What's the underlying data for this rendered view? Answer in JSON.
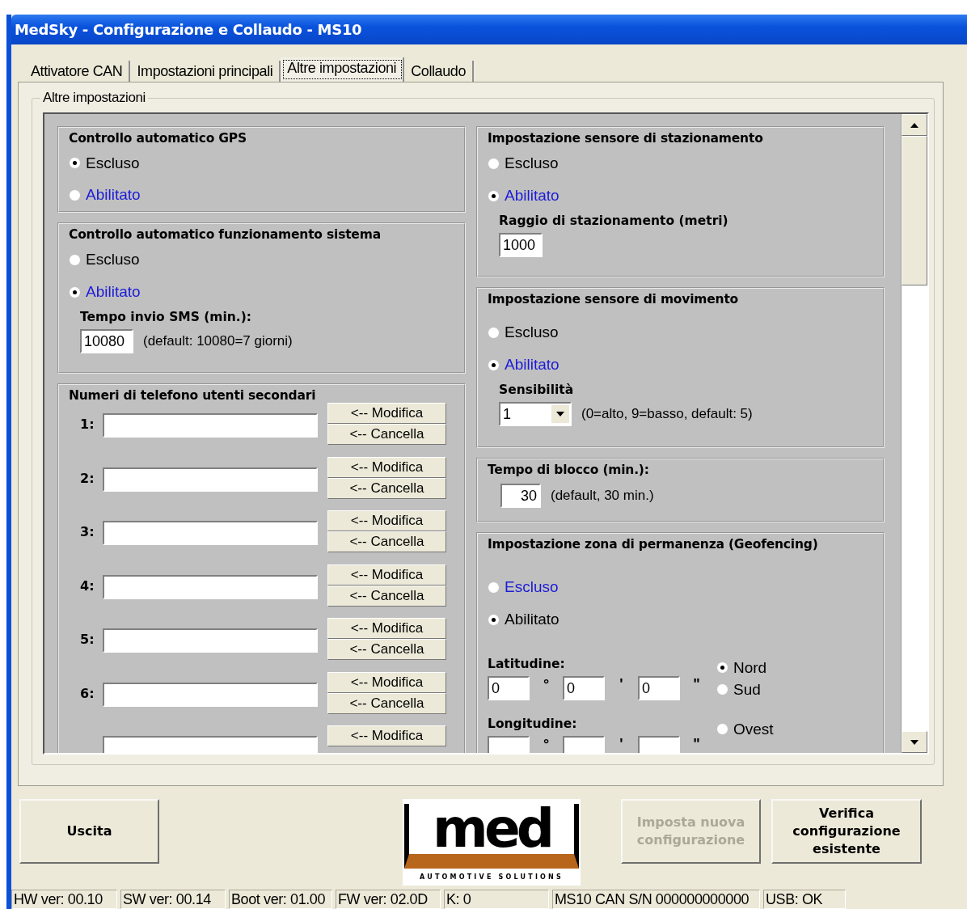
{
  "window": {
    "title": "MedSky - Configurazione e Collaudo - MS10"
  },
  "tabs": [
    {
      "label": "Attivatore CAN",
      "selected": false
    },
    {
      "label": "Impostazioni principali",
      "selected": false
    },
    {
      "label": "Altre impostazioni",
      "selected": true
    },
    {
      "label": "Collaudo",
      "selected": false
    }
  ],
  "group_label": "Altre impostazioni",
  "gps": {
    "title": "Controllo automatico GPS",
    "options": [
      {
        "label": "Escluso",
        "selected": true,
        "color": "#000000"
      },
      {
        "label": "Abilitato",
        "selected": false,
        "color": "#1c1cd8"
      }
    ]
  },
  "system": {
    "title": "Controllo automatico funzionamento sistema",
    "options": [
      {
        "label": "Escluso",
        "selected": false,
        "color": "#000000"
      },
      {
        "label": "Abilitato",
        "selected": true,
        "color": "#1c1cd8"
      }
    ],
    "sms_label": "Tempo invio SMS (min.):",
    "sms_value": "10080",
    "sms_hint": "(default: 10080=7 giorni)"
  },
  "phones": {
    "title": "Numeri di telefono utenti secondari",
    "rows": [
      {
        "label": "1:",
        "modify": "<-- Modifica",
        "delete": "<-- Cancella"
      },
      {
        "label": "2:",
        "modify": "<-- Modifica",
        "delete": "<-- Cancella"
      },
      {
        "label": "3:",
        "modify": "<-- Modifica",
        "delete": "<-- Cancella"
      },
      {
        "label": "4:",
        "modify": "<-- Modifica",
        "delete": "<-- Cancella"
      },
      {
        "label": "5:",
        "modify": "<-- Modifica",
        "delete": "<-- Cancella"
      },
      {
        "label": "6:",
        "modify": "<-- Modifica",
        "delete": "<-- Cancella"
      },
      {
        "modify": "<-- Modifica"
      }
    ]
  },
  "parking": {
    "title": "Impostazione sensore di stazionamento",
    "options": [
      {
        "label": "Escluso",
        "selected": false,
        "color": "#000000"
      },
      {
        "label": "Abilitato",
        "selected": true,
        "color": "#1c1cd8"
      }
    ],
    "radius_label": "Raggio di stazionamento (metri)",
    "radius_value": "1000"
  },
  "motion": {
    "title": "Impostazione sensore di movimento",
    "options": [
      {
        "label": "Escluso",
        "selected": false,
        "color": "#000000"
      },
      {
        "label": "Abilitato",
        "selected": true,
        "color": "#1c1cd8"
      }
    ],
    "sens_label": "Sensibilità",
    "sens_value": "1",
    "sens_hint": "(0=alto, 9=basso, default: 5)"
  },
  "lock": {
    "title": "Tempo di blocco (min.):",
    "value": "30",
    "hint": "(default, 30 min.)"
  },
  "geofence": {
    "title": "Impostazione zona di permanenza (Geofencing)",
    "options": [
      {
        "label": "Escluso",
        "selected": false,
        "color": "#1c1cd8"
      },
      {
        "label": "Abilitato",
        "selected": true,
        "color": "#000000"
      }
    ],
    "lat_label": "Latitudine:",
    "lat_fields": [
      "0",
      "0",
      "0"
    ],
    "marks": [
      "°",
      "'",
      "\""
    ],
    "lat_hemis": [
      {
        "label": "Nord",
        "selected": true
      },
      {
        "label": "Sud",
        "selected": false
      }
    ],
    "lon_label": "Longitudine:",
    "lon_hemis": [
      {
        "label": "Ovest",
        "selected": false
      }
    ]
  },
  "buttons": {
    "exit": "Uscita",
    "apply": {
      "label": "Imposta nuova configurazione",
      "disabled": true
    },
    "verify": {
      "label": "Verifica configurazione esistente",
      "disabled": false
    }
  },
  "logo": {
    "wordmark": "med",
    "tagline": "AUTOMOTIVE SOLUTIONS"
  },
  "status_bar": [
    "HW ver: 00.10",
    "SW ver: 00.14",
    "Boot ver: 01.00",
    "FW ver: 02.0D",
    "K: 0",
    "MS10 CAN S/N 000000000000",
    "USB: OK"
  ]
}
